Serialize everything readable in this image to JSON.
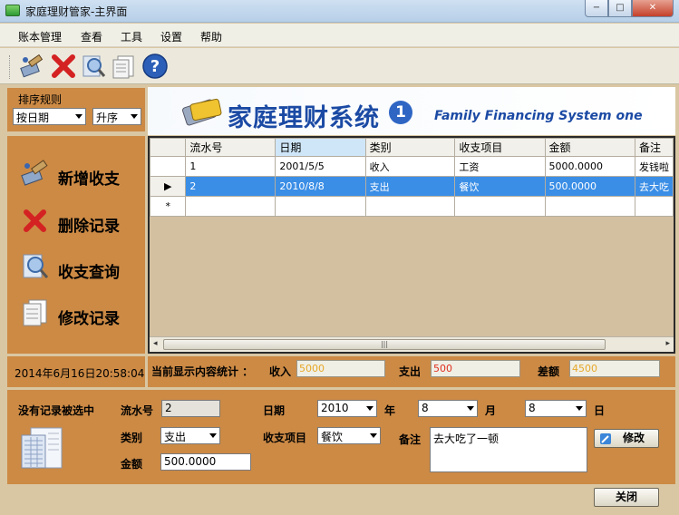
{
  "window": {
    "title": "家庭理财管家-主界面",
    "min": "−",
    "max": "□",
    "close": "✕"
  },
  "menu": [
    "账本管理",
    "查看",
    "工具",
    "设置",
    "帮助"
  ],
  "toolbar": [
    "add-record-icon",
    "delete-icon",
    "search-icon",
    "edit-document-icon",
    "help-icon"
  ],
  "sort": {
    "label": "排序规则",
    "field": "按日期",
    "order": "升序"
  },
  "banner": {
    "cn": "家庭理财系统",
    "num": "1",
    "en": "Family Financing System one"
  },
  "side": {
    "add": "新增收支",
    "delete": "删除记录",
    "query": "收支查询",
    "edit": "修改记录"
  },
  "grid": {
    "columns": [
      "流水号",
      "日期",
      "类别",
      "收支项目",
      "金额",
      "备注"
    ],
    "rows": [
      [
        "1",
        "2001/5/5",
        "收入",
        "工资",
        "5000.0000",
        "发钱啦"
      ],
      [
        "2",
        "2010/8/8",
        "支出",
        "餐饮",
        "500.0000",
        "去大吃"
      ]
    ],
    "new_row_marker": "*",
    "selected_marker": "▶",
    "scroll_grip": "|||",
    "scroll_left": "◂",
    "scroll_right": "▸"
  },
  "datetime": "2014年6月16日20:58:04",
  "stats": {
    "label": "当前显示内容统计 ：",
    "income_label": "收入",
    "income": "5000",
    "expense_label": "支出",
    "expense": "500",
    "balance_label": "差额",
    "balance": "4500"
  },
  "form": {
    "status": "没有记录被选中",
    "id_label": "流水号",
    "id": "2",
    "date_label": "日期",
    "year": "2010",
    "year_unit": "年",
    "month": "8",
    "month_unit": "月",
    "day": "8",
    "day_unit": "日",
    "type_label": "类别",
    "type": "支出",
    "item_label": "收支项目",
    "item": "餐饮",
    "memo_label": "备注",
    "memo": "去大吃了一顿",
    "amount_label": "金额",
    "amount": "500.0000",
    "modify": "修改",
    "close": "关闭"
  },
  "colors": {
    "panel": "#cc8a45",
    "selection": "#3a8ee6",
    "banner_text": "#1b4aa4"
  }
}
